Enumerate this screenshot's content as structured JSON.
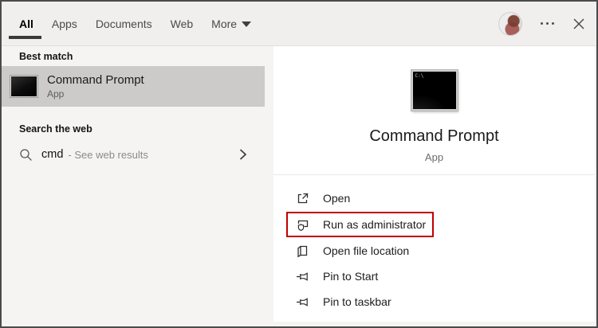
{
  "tabs": {
    "items": [
      {
        "label": "All",
        "active": true
      },
      {
        "label": "Apps",
        "active": false
      },
      {
        "label": "Documents",
        "active": false
      },
      {
        "label": "Web",
        "active": false
      },
      {
        "label": "More",
        "active": false,
        "has_dropdown": true
      }
    ]
  },
  "left": {
    "best_match_heading": "Best match",
    "best_match": {
      "title": "Command Prompt",
      "subtitle": "App"
    },
    "search_web_heading": "Search the web",
    "web_row": {
      "query": "cmd",
      "suffix": "- See web results"
    }
  },
  "detail": {
    "title": "Command Prompt",
    "subtitle": "App",
    "terminal_prompt": "C:\\",
    "actions": [
      {
        "label": "Open",
        "icon": "launch-icon",
        "highlighted": false
      },
      {
        "label": "Run as administrator",
        "icon": "admin-shield-icon",
        "highlighted": true
      },
      {
        "label": "Open file location",
        "icon": "file-location-icon",
        "highlighted": false
      },
      {
        "label": "Pin to Start",
        "icon": "pin-icon",
        "highlighted": false
      },
      {
        "label": "Pin to taskbar",
        "icon": "pin-icon",
        "highlighted": false
      }
    ]
  },
  "colors": {
    "annotation_red": "#c00000",
    "highlight_row": "#cccbc9",
    "active_tab_underline": "#3a3a3a",
    "card_background": "#ffffff",
    "panel_background": "#f5f4f2"
  }
}
